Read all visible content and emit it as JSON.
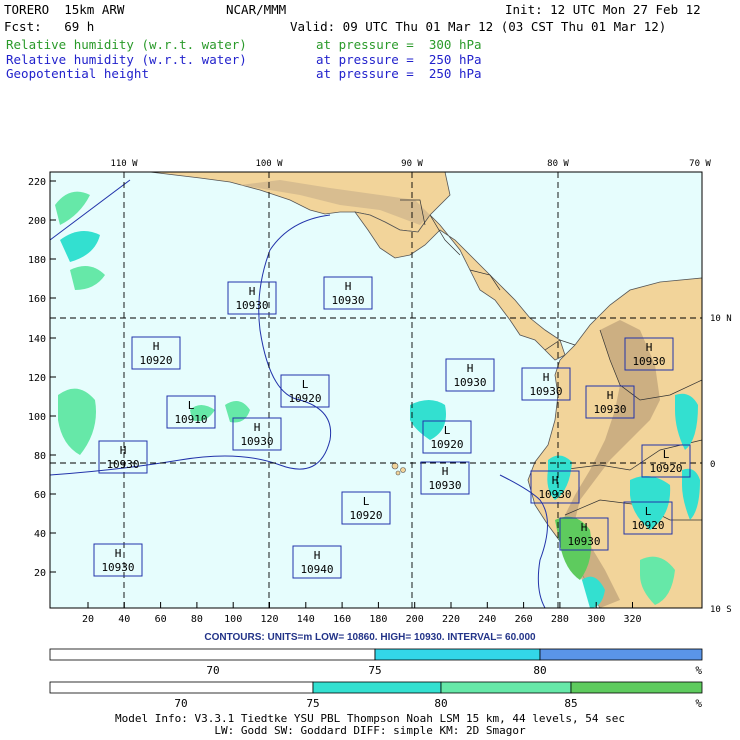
{
  "header": {
    "model": "TORERO  15km ARW",
    "center": "NCAR/MMM",
    "init": "Init: 12 UTC Mon 27 Feb 12",
    "fcst": "Fcst:   69 h",
    "valid": "Valid: 09 UTC Thu 01 Mar 12 (03 CST Thu 01 Mar 12)",
    "fields": [
      {
        "name": "Relative humidity (w.r.t. water)",
        "level": "at pressure =  300 hPa",
        "color": "#2a9a2a"
      },
      {
        "name": "Relative humidity (w.r.t. water)",
        "level": "at pressure =  250 hPa",
        "color": "#2222cc"
      },
      {
        "name": "Geopotential height",
        "level": "at pressure =  250 hPa",
        "color": "#2222cc"
      }
    ]
  },
  "map": {
    "top_lon_labels": [
      "110 W",
      "100 W",
      "90 W",
      "80 W",
      "70 W"
    ],
    "right_lat_labels": [
      "10 N",
      "0",
      "10 S"
    ],
    "y_ticks": [
      "220",
      "200",
      "180",
      "160",
      "140",
      "120",
      "100",
      "80",
      "60",
      "40",
      "20"
    ],
    "x_ticks": [
      "20",
      "40",
      "60",
      "80",
      "100",
      "120",
      "140",
      "160",
      "180",
      "200",
      "220",
      "240",
      "260",
      "280",
      "300",
      "320"
    ],
    "centers": [
      {
        "type": "H",
        "value": "10930"
      },
      {
        "type": "H",
        "value": "10930"
      },
      {
        "type": "H",
        "value": "10920"
      },
      {
        "type": "L",
        "value": "10920"
      },
      {
        "type": "H",
        "value": "10930"
      },
      {
        "type": "H",
        "value": "10930"
      },
      {
        "type": "H",
        "value": "10930"
      },
      {
        "type": "L",
        "value": "10910"
      },
      {
        "type": "H",
        "value": "10930"
      },
      {
        "type": "H",
        "value": "10930"
      },
      {
        "type": "L",
        "value": "10920"
      },
      {
        "type": "H",
        "value": "10930"
      },
      {
        "type": "H",
        "value": "10930"
      },
      {
        "type": "L",
        "value": "10920"
      },
      {
        "type": "L",
        "value": "10920"
      },
      {
        "type": "H",
        "value": "10930"
      },
      {
        "type": "L",
        "value": "10920"
      },
      {
        "type": "H",
        "value": "10930"
      },
      {
        "type": "H",
        "value": "10940"
      },
      {
        "type": "H",
        "value": "10930"
      }
    ]
  },
  "contours_line": "CONTOURS:  UNITS=m  LOW=  10860.     HIGH=  10930.     INTERVAL=   60.000",
  "scale1": {
    "labels": [
      "70",
      "75",
      "80",
      "%"
    ],
    "colors": [
      "#ffffff",
      "#33d6e8",
      "#5a95e8"
    ]
  },
  "scale2": {
    "labels": [
      "70",
      "75",
      "80",
      "85",
      "%"
    ],
    "colors": [
      "#ffffff",
      "#33e0d0",
      "#66e8a8",
      "#5ecb5e"
    ]
  },
  "footer": {
    "line1": "Model Info: V3.3.1   Tiedtke YSU PBL  Thompson   Noah LSM  15 km,   44 levels,   54 sec",
    "line2": "LW: Godd SW: Goddard DIFF: simple KM: 2D Smagor"
  },
  "colors": {
    "ocean": "#e6fdfd",
    "land": "#f2d49a",
    "mountains": "#c9b08a",
    "grid": "#000000",
    "label_box": "#2233aa"
  }
}
